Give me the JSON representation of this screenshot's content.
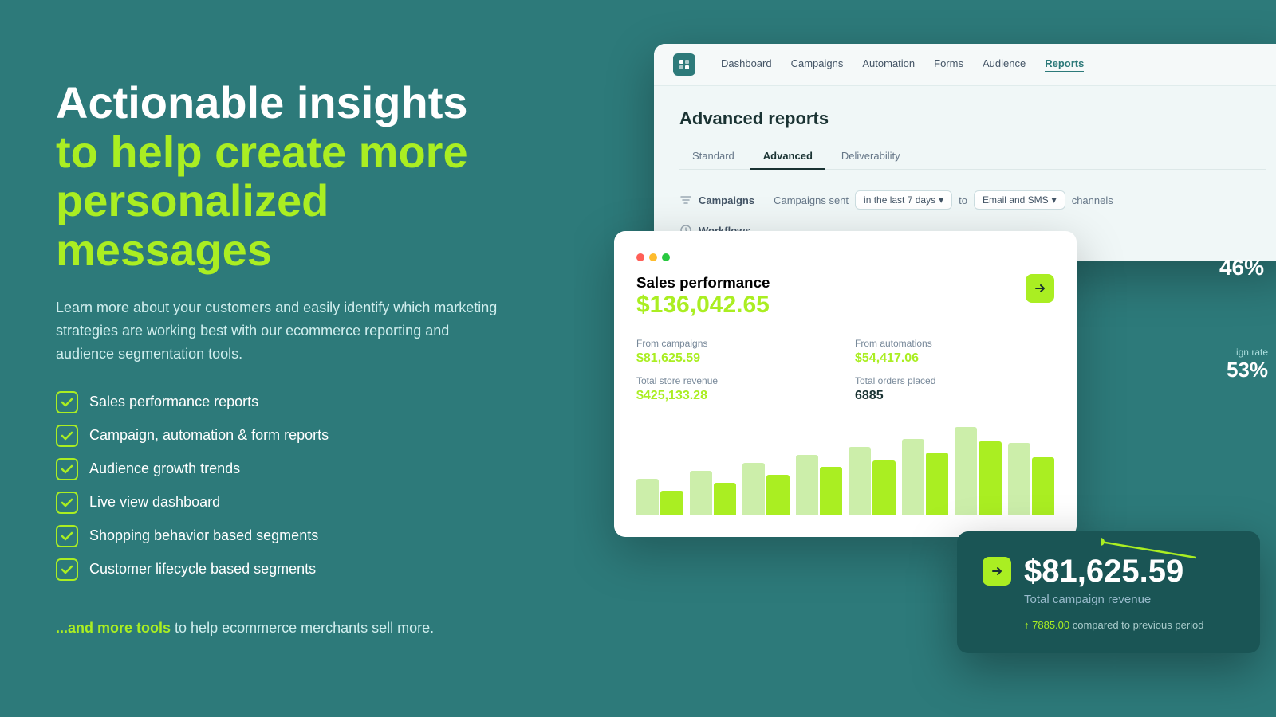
{
  "left": {
    "headline_white": "Actionable insights",
    "headline_green": "to help create more personalized messages",
    "description": "Learn more about your customers and easily identify which marketing strategies are working best with our ecommerce reporting and audience segmentation tools.",
    "checklist": [
      "Sales performance reports",
      "Campaign, automation & form reports",
      "Audience growth trends",
      "Live view dashboard",
      "Shopping behavior based segments",
      "Customer lifecycle based segments"
    ],
    "footer_prefix": "...and more tools",
    "footer_suffix": " to help ecommerce merchants sell more."
  },
  "nav": {
    "logo": "O",
    "items": [
      "Dashboard",
      "Campaigns",
      "Automation",
      "Forms",
      "Audience",
      "Reports"
    ]
  },
  "reports": {
    "title": "Advanced reports",
    "tabs": [
      "Standard",
      "Advanced",
      "Deliverability"
    ],
    "active_tab": "Advanced",
    "filter_rows": [
      {
        "icon": "campaign",
        "label": "Campaigns",
        "details": "Campaigns sent",
        "period": "in the last 7 days",
        "separator": "to",
        "channel": "Email and SMS",
        "channels_label": "channels"
      },
      {
        "icon": "workflow",
        "label": "Workflows"
      }
    ]
  },
  "sales": {
    "title": "Sales performance",
    "total": "$136,042.65",
    "metrics": [
      {
        "label": "From campaigns",
        "value": "$81,625.59",
        "green": true
      },
      {
        "label": "From automations",
        "value": "$54,417.06",
        "green": true
      },
      {
        "label": "Total store revenue",
        "value": "$425,133.28",
        "green": true
      },
      {
        "label": "Total orders placed",
        "value": "6885",
        "green": false
      }
    ],
    "bars": [
      {
        "light": 45,
        "bright": 30
      },
      {
        "light": 55,
        "bright": 40
      },
      {
        "light": 60,
        "bright": 50
      },
      {
        "light": 70,
        "bright": 55
      },
      {
        "light": 80,
        "bright": 65
      },
      {
        "light": 90,
        "bright": 75
      },
      {
        "light": 100,
        "bright": 85
      },
      {
        "light": 85,
        "bright": 70
      }
    ]
  },
  "stat": {
    "amount": "$81,625.59",
    "label": "Total campaign revenue",
    "comparison_prefix": "compared to previous period",
    "comparison_value": "7885.00"
  },
  "float_labels": {
    "top_percent": "46%",
    "mid_text": "53%",
    "mid_label": "ign rate"
  },
  "colors": {
    "bg": "#2d7a7a",
    "green": "#aaee22",
    "dark_card": "#1a5555",
    "white": "#ffffff"
  }
}
